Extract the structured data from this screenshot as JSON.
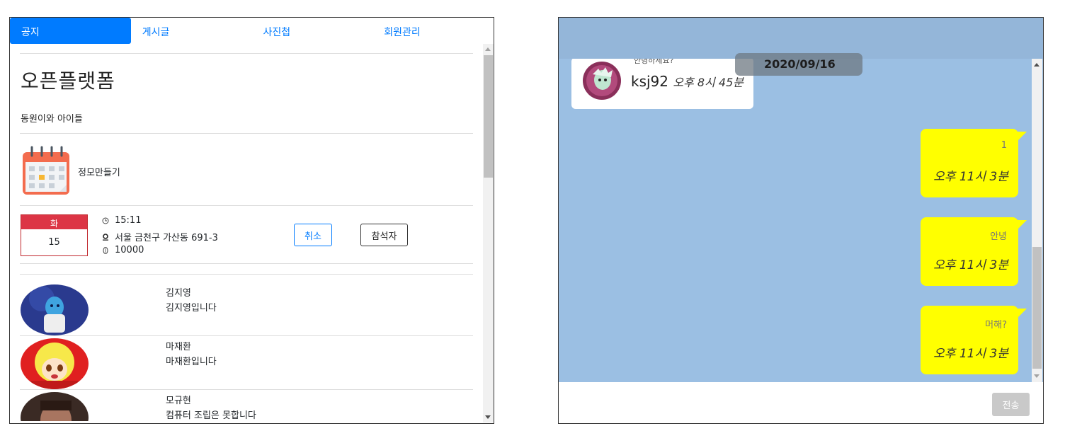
{
  "tabs": [
    {
      "label": "공지",
      "active": true
    },
    {
      "label": "게시글",
      "active": false
    },
    {
      "label": "사진첩",
      "active": false
    },
    {
      "label": "회원관리",
      "active": false
    }
  ],
  "group": {
    "title": "오픈플랫폼",
    "description": "동원이와 아이들"
  },
  "meetup": {
    "create_label": "정모만들기",
    "day_of_week": "화",
    "day_number": "15",
    "time": "15:11",
    "location": "서울 금천구 가산동 691-3",
    "cost": "10000",
    "cancel_label": "취소",
    "attendees_label": "참석자"
  },
  "members": [
    {
      "name": "김지영",
      "intro": "김지영입니다"
    },
    {
      "name": "마재환",
      "intro": "마재환입니다"
    },
    {
      "name": "모규현",
      "intro": "컴퓨터 조립은 못합니다"
    }
  ],
  "chat": {
    "date": "2020/09/16",
    "previous_message": {
      "username": "ksj92",
      "time": "오후 8시 45분"
    },
    "messages": [
      {
        "text": "1",
        "time": "오후 11시 3분"
      },
      {
        "text": "안녕",
        "time": "오후 11시 3분"
      },
      {
        "text": "머해?",
        "time": "오후 11시 3분"
      }
    ],
    "send_label": "전송"
  },
  "colors": {
    "accent": "#007bff",
    "day_badge": "#dc3545",
    "chat_bg": "#9bbfe3",
    "bubble": "#ffff00"
  }
}
